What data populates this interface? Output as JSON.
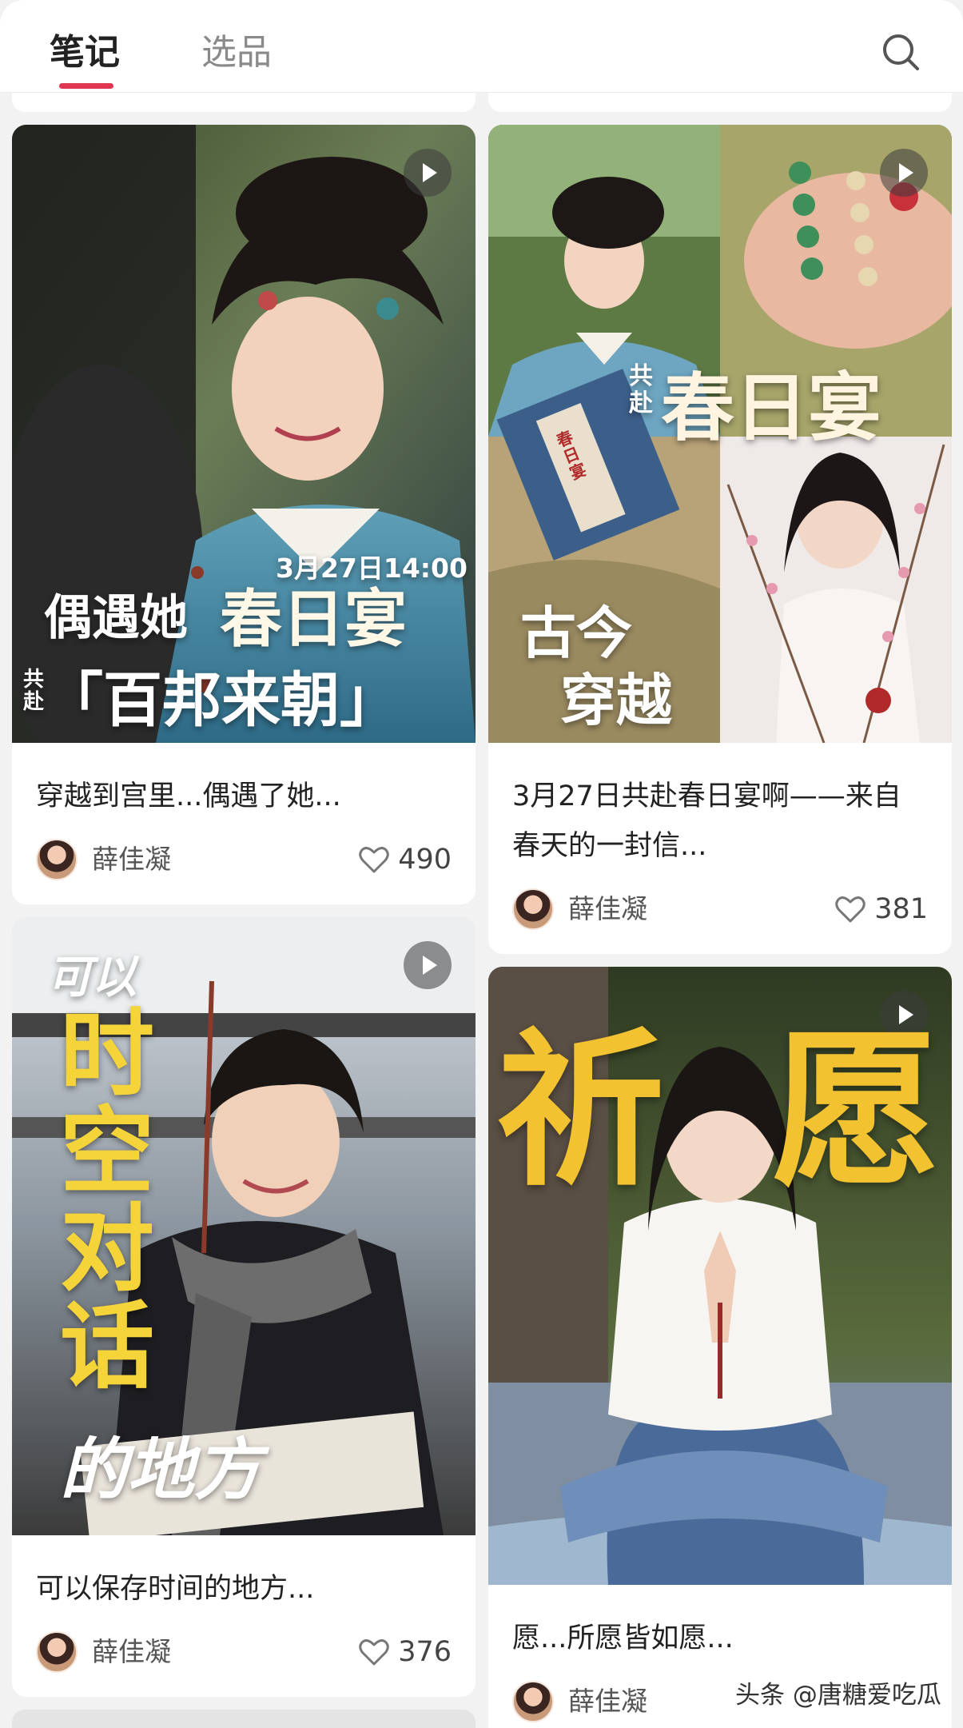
{
  "tabs": [
    {
      "label": "笔记",
      "active": true
    },
    {
      "label": "选品",
      "active": false
    }
  ],
  "accent_color": "#e0364f",
  "cards": [
    {
      "title": "穿越到宫里...偶遇了她...",
      "author": "薛佳凝",
      "likes": "490",
      "is_video": true,
      "overlay": {
        "time": "3月27日14:00",
        "line1a": "偶遇她",
        "line1b": "春日宴",
        "line2_prefix": "共赴",
        "line2": "「百邦来朝」"
      }
    },
    {
      "title": "3月27日共赴春日宴啊——来自春天的一封信...",
      "author": "薛佳凝",
      "likes": "381",
      "is_video": true,
      "overlay": {
        "prefix": "共赴",
        "main": "春日宴",
        "sub1": "古今",
        "sub2": "穿越",
        "envelope": "春日宴"
      }
    },
    {
      "title": "可以保存时间的地方...",
      "author": "薛佳凝",
      "likes": "376",
      "is_video": true,
      "overlay": {
        "top": "可以",
        "vertical": [
          "时",
          "空",
          "对",
          "话"
        ],
        "bottom": "的地方"
      }
    },
    {
      "title": "愿...所愿皆如愿...",
      "author": "薛佳凝",
      "likes": "",
      "is_video": true,
      "overlay": {
        "left": "祈",
        "right": "愿"
      }
    }
  ],
  "watermark": "头条 @唐糖爱吃瓜"
}
